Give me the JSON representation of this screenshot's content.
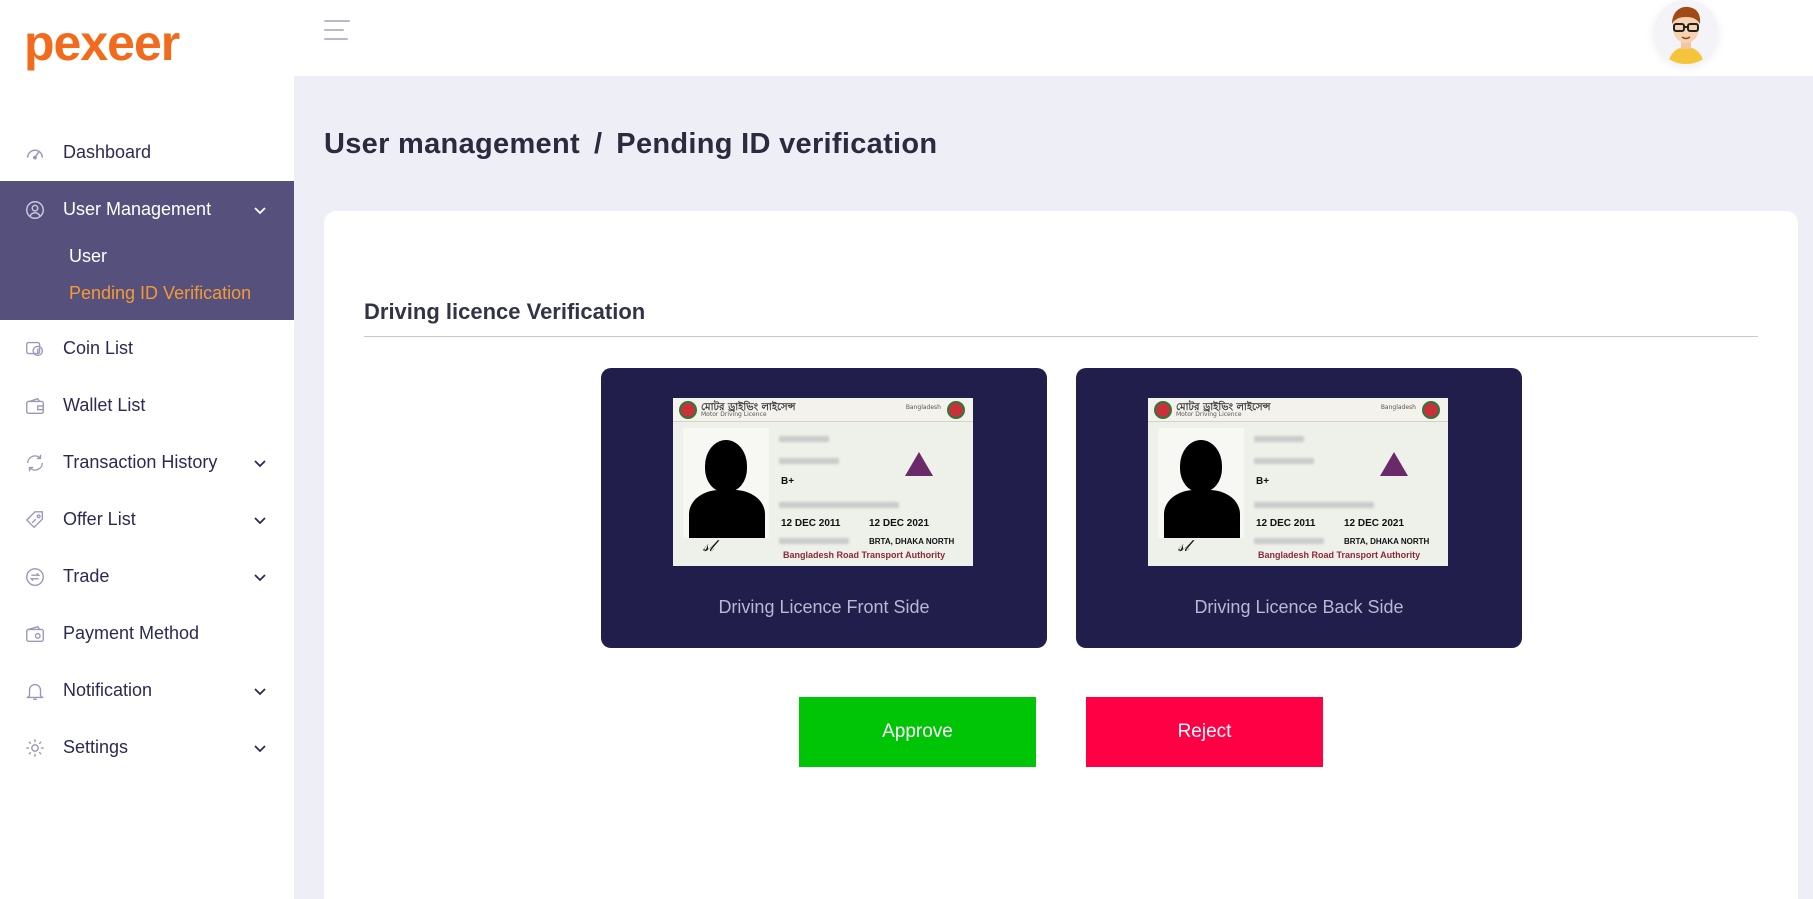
{
  "brand": {
    "logo": "pexeer",
    "logo_color": "#f26a1b"
  },
  "sidebar": {
    "items": [
      {
        "label": "Dashboard",
        "icon": "speedometer-icon"
      },
      {
        "label": "User Management",
        "icon": "user-circle-icon",
        "expanded": true
      },
      {
        "label": "Coin List",
        "icon": "coins-icon"
      },
      {
        "label": "Wallet List",
        "icon": "wallet-icon"
      },
      {
        "label": "Transaction History",
        "icon": "transaction-icon"
      },
      {
        "label": "Offer List",
        "icon": "tag-icon"
      },
      {
        "label": "Trade",
        "icon": "exchange-icon"
      },
      {
        "label": "Payment Method",
        "icon": "payment-icon"
      },
      {
        "label": "Notification",
        "icon": "bell-icon"
      },
      {
        "label": "Settings",
        "icon": "gear-icon"
      }
    ],
    "user_submenu": [
      {
        "label": "User"
      },
      {
        "label": "Pending ID Verification",
        "current": true
      }
    ],
    "active_bg": "#55517c",
    "current_color": "#f59a32"
  },
  "breadcrumb": {
    "parent": "User management",
    "separator": "/",
    "current": "Pending ID verification"
  },
  "section": {
    "title": "Driving licence Verification"
  },
  "documents": [
    {
      "caption": "Driving Licence Front Side"
    },
    {
      "caption": "Driving Licence Back Side"
    }
  ],
  "id_card": {
    "header_bn": "মোটর ড্রাইভিং লাইসেন্স",
    "header_en": "Motor Driving Licence",
    "header_right": "Bangladesh",
    "blood_group": "B+",
    "issue_date": "12 DEC 2011",
    "validity": "12 DEC 2021",
    "authority": "BRTA, DHAKA NORTH",
    "footer": "Bangladesh Road Transport Authority"
  },
  "actions": {
    "approve": "Approve",
    "reject": "Reject"
  },
  "colors": {
    "approve": "#00c507",
    "reject": "#ff0044",
    "doc_card_bg": "#221e4b"
  }
}
